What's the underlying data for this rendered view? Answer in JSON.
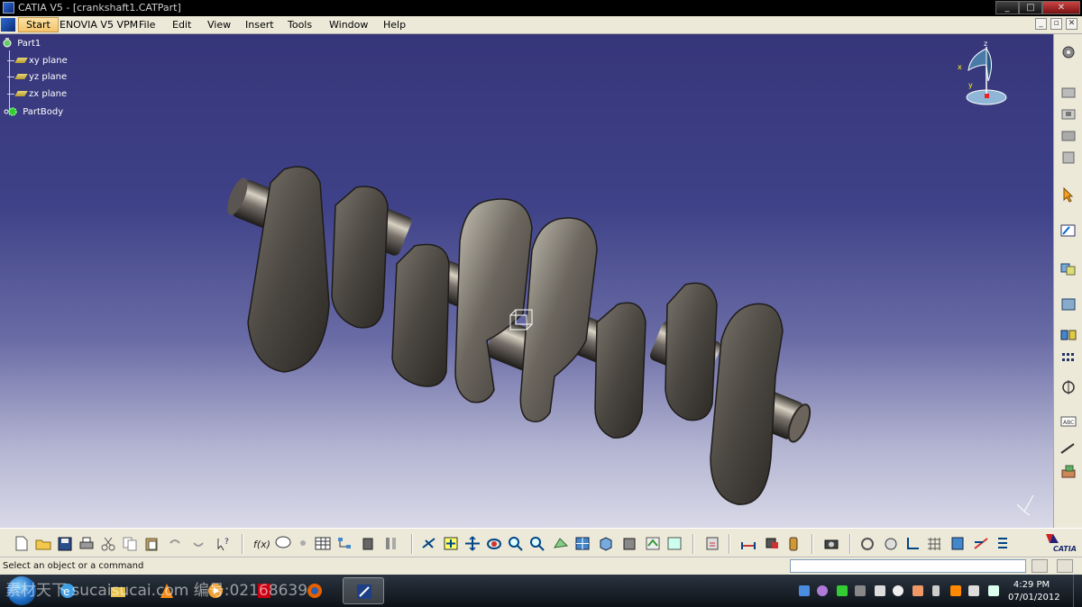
{
  "window": {
    "title": "CATIA V5 - [crankshaft1.CATPart]",
    "controls": [
      "_",
      "□",
      "✕"
    ]
  },
  "menu": {
    "start_label": "Start",
    "items": [
      "ENOVIA V5 VPM",
      "File",
      "Edit",
      "View",
      "Insert",
      "Tools",
      "Window",
      "Help"
    ],
    "mdi_controls": [
      "_",
      "▫",
      "✕"
    ]
  },
  "tree": {
    "root": "Part1",
    "children": [
      "xy plane",
      "yz plane",
      "zx plane",
      "PartBody"
    ]
  },
  "compass": {
    "labels": [
      "z",
      "x",
      "y"
    ]
  },
  "status": {
    "prompt": "Select an object or a command"
  },
  "brand": {
    "logo_text": "CATIA"
  },
  "clock": {
    "time": "4:29 PM",
    "date": "07/01/2012"
  },
  "watermark": {
    "text": "素材天下 sucaisucai.com  编号:02168639"
  },
  "colors": {
    "viewport_top": "#36357a",
    "viewport_bottom": "#d9d9e8",
    "toolbar": "#ece9d8",
    "menu_start": "#f3c46b"
  }
}
